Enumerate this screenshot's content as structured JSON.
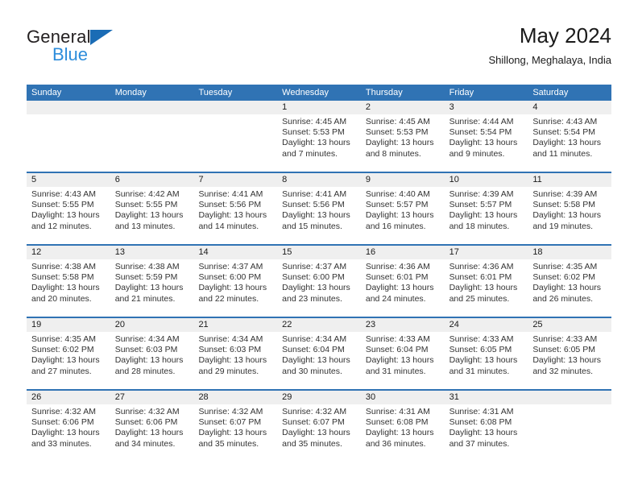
{
  "brand": {
    "word_one": "General",
    "word_two": "Blue",
    "mark": "triangle-logo"
  },
  "header": {
    "title": "May 2024",
    "subtitle": "Shillong, Meghalaya, India"
  },
  "colors": {
    "header_blue": "#3073B4",
    "brand_blue": "#2D8DDB",
    "day_band_gray": "#EFEFEF",
    "text": "#333333"
  },
  "calendar": {
    "weekday_headers": [
      "Sunday",
      "Monday",
      "Tuesday",
      "Wednesday",
      "Thursday",
      "Friday",
      "Saturday"
    ],
    "weeks": [
      [
        {
          "day": "",
          "empty": true
        },
        {
          "day": "",
          "empty": true
        },
        {
          "day": "",
          "empty": true
        },
        {
          "day": "1",
          "sunrise": "Sunrise: 4:45 AM",
          "sunset": "Sunset: 5:53 PM",
          "daylight_line1": "Daylight: 13 hours",
          "daylight_line2": "and 7 minutes."
        },
        {
          "day": "2",
          "sunrise": "Sunrise: 4:45 AM",
          "sunset": "Sunset: 5:53 PM",
          "daylight_line1": "Daylight: 13 hours",
          "daylight_line2": "and 8 minutes."
        },
        {
          "day": "3",
          "sunrise": "Sunrise: 4:44 AM",
          "sunset": "Sunset: 5:54 PM",
          "daylight_line1": "Daylight: 13 hours",
          "daylight_line2": "and 9 minutes."
        },
        {
          "day": "4",
          "sunrise": "Sunrise: 4:43 AM",
          "sunset": "Sunset: 5:54 PM",
          "daylight_line1": "Daylight: 13 hours",
          "daylight_line2": "and 11 minutes."
        }
      ],
      [
        {
          "day": "5",
          "sunrise": "Sunrise: 4:43 AM",
          "sunset": "Sunset: 5:55 PM",
          "daylight_line1": "Daylight: 13 hours",
          "daylight_line2": "and 12 minutes."
        },
        {
          "day": "6",
          "sunrise": "Sunrise: 4:42 AM",
          "sunset": "Sunset: 5:55 PM",
          "daylight_line1": "Daylight: 13 hours",
          "daylight_line2": "and 13 minutes."
        },
        {
          "day": "7",
          "sunrise": "Sunrise: 4:41 AM",
          "sunset": "Sunset: 5:56 PM",
          "daylight_line1": "Daylight: 13 hours",
          "daylight_line2": "and 14 minutes."
        },
        {
          "day": "8",
          "sunrise": "Sunrise: 4:41 AM",
          "sunset": "Sunset: 5:56 PM",
          "daylight_line1": "Daylight: 13 hours",
          "daylight_line2": "and 15 minutes."
        },
        {
          "day": "9",
          "sunrise": "Sunrise: 4:40 AM",
          "sunset": "Sunset: 5:57 PM",
          "daylight_line1": "Daylight: 13 hours",
          "daylight_line2": "and 16 minutes."
        },
        {
          "day": "10",
          "sunrise": "Sunrise: 4:39 AM",
          "sunset": "Sunset: 5:57 PM",
          "daylight_line1": "Daylight: 13 hours",
          "daylight_line2": "and 18 minutes."
        },
        {
          "day": "11",
          "sunrise": "Sunrise: 4:39 AM",
          "sunset": "Sunset: 5:58 PM",
          "daylight_line1": "Daylight: 13 hours",
          "daylight_line2": "and 19 minutes."
        }
      ],
      [
        {
          "day": "12",
          "sunrise": "Sunrise: 4:38 AM",
          "sunset": "Sunset: 5:58 PM",
          "daylight_line1": "Daylight: 13 hours",
          "daylight_line2": "and 20 minutes."
        },
        {
          "day": "13",
          "sunrise": "Sunrise: 4:38 AM",
          "sunset": "Sunset: 5:59 PM",
          "daylight_line1": "Daylight: 13 hours",
          "daylight_line2": "and 21 minutes."
        },
        {
          "day": "14",
          "sunrise": "Sunrise: 4:37 AM",
          "sunset": "Sunset: 6:00 PM",
          "daylight_line1": "Daylight: 13 hours",
          "daylight_line2": "and 22 minutes."
        },
        {
          "day": "15",
          "sunrise": "Sunrise: 4:37 AM",
          "sunset": "Sunset: 6:00 PM",
          "daylight_line1": "Daylight: 13 hours",
          "daylight_line2": "and 23 minutes."
        },
        {
          "day": "16",
          "sunrise": "Sunrise: 4:36 AM",
          "sunset": "Sunset: 6:01 PM",
          "daylight_line1": "Daylight: 13 hours",
          "daylight_line2": "and 24 minutes."
        },
        {
          "day": "17",
          "sunrise": "Sunrise: 4:36 AM",
          "sunset": "Sunset: 6:01 PM",
          "daylight_line1": "Daylight: 13 hours",
          "daylight_line2": "and 25 minutes."
        },
        {
          "day": "18",
          "sunrise": "Sunrise: 4:35 AM",
          "sunset": "Sunset: 6:02 PM",
          "daylight_line1": "Daylight: 13 hours",
          "daylight_line2": "and 26 minutes."
        }
      ],
      [
        {
          "day": "19",
          "sunrise": "Sunrise: 4:35 AM",
          "sunset": "Sunset: 6:02 PM",
          "daylight_line1": "Daylight: 13 hours",
          "daylight_line2": "and 27 minutes."
        },
        {
          "day": "20",
          "sunrise": "Sunrise: 4:34 AM",
          "sunset": "Sunset: 6:03 PM",
          "daylight_line1": "Daylight: 13 hours",
          "daylight_line2": "and 28 minutes."
        },
        {
          "day": "21",
          "sunrise": "Sunrise: 4:34 AM",
          "sunset": "Sunset: 6:03 PM",
          "daylight_line1": "Daylight: 13 hours",
          "daylight_line2": "and 29 minutes."
        },
        {
          "day": "22",
          "sunrise": "Sunrise: 4:34 AM",
          "sunset": "Sunset: 6:04 PM",
          "daylight_line1": "Daylight: 13 hours",
          "daylight_line2": "and 30 minutes."
        },
        {
          "day": "23",
          "sunrise": "Sunrise: 4:33 AM",
          "sunset": "Sunset: 6:04 PM",
          "daylight_line1": "Daylight: 13 hours",
          "daylight_line2": "and 31 minutes."
        },
        {
          "day": "24",
          "sunrise": "Sunrise: 4:33 AM",
          "sunset": "Sunset: 6:05 PM",
          "daylight_line1": "Daylight: 13 hours",
          "daylight_line2": "and 31 minutes."
        },
        {
          "day": "25",
          "sunrise": "Sunrise: 4:33 AM",
          "sunset": "Sunset: 6:05 PM",
          "daylight_line1": "Daylight: 13 hours",
          "daylight_line2": "and 32 minutes."
        }
      ],
      [
        {
          "day": "26",
          "sunrise": "Sunrise: 4:32 AM",
          "sunset": "Sunset: 6:06 PM",
          "daylight_line1": "Daylight: 13 hours",
          "daylight_line2": "and 33 minutes."
        },
        {
          "day": "27",
          "sunrise": "Sunrise: 4:32 AM",
          "sunset": "Sunset: 6:06 PM",
          "daylight_line1": "Daylight: 13 hours",
          "daylight_line2": "and 34 minutes."
        },
        {
          "day": "28",
          "sunrise": "Sunrise: 4:32 AM",
          "sunset": "Sunset: 6:07 PM",
          "daylight_line1": "Daylight: 13 hours",
          "daylight_line2": "and 35 minutes."
        },
        {
          "day": "29",
          "sunrise": "Sunrise: 4:32 AM",
          "sunset": "Sunset: 6:07 PM",
          "daylight_line1": "Daylight: 13 hours",
          "daylight_line2": "and 35 minutes."
        },
        {
          "day": "30",
          "sunrise": "Sunrise: 4:31 AM",
          "sunset": "Sunset: 6:08 PM",
          "daylight_line1": "Daylight: 13 hours",
          "daylight_line2": "and 36 minutes."
        },
        {
          "day": "31",
          "sunrise": "Sunrise: 4:31 AM",
          "sunset": "Sunset: 6:08 PM",
          "daylight_line1": "Daylight: 13 hours",
          "daylight_line2": "and 37 minutes."
        },
        {
          "day": "",
          "empty": true
        }
      ]
    ]
  }
}
